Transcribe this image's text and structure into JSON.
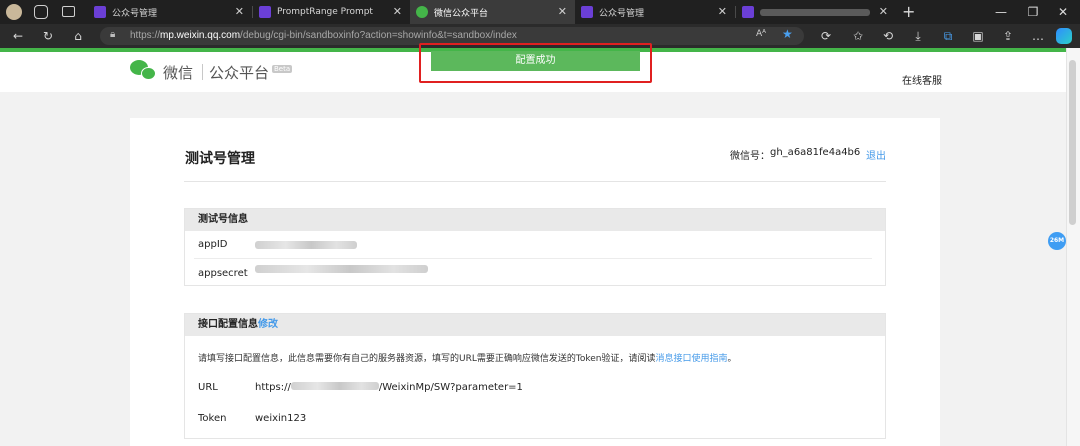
{
  "browser": {
    "tabs": [
      {
        "title": "公众号管理",
        "active": false
      },
      {
        "title": "PromptRange Prompt",
        "active": false
      },
      {
        "title": "微信公众平台",
        "active": true
      },
      {
        "title": "公众号管理",
        "active": false
      },
      {
        "title": "",
        "active": false
      }
    ],
    "url_host": "mp.weixin.qq.com",
    "url_prefix": "https://",
    "url_path": "/debug/cgi-bin/sandboxinfo?action=showinfo&t=sandbox/index",
    "reader_mode": "A ᴬ"
  },
  "header": {
    "brand": "微信",
    "platform": "公众平台",
    "beta": "Beta",
    "online_service": "在线客服",
    "toast": "配置成功"
  },
  "test_account": {
    "title": "测试号管理",
    "wechat_label": "微信号：",
    "wechat_id": "gh_a6a81fe4a4b6",
    "logout": "退出"
  },
  "info_section": {
    "heading": "测试号信息",
    "appid_label": "appID",
    "appsecret_label": "appsecret"
  },
  "config_section": {
    "heading": "接口配置信息",
    "edit_link": "修改",
    "desc": "请填写接口配置信息，此信息需要你有自己的服务器资源，填写的URL需要正确响应微信发送的Token验证，请阅读",
    "guide_link": "消息接口使用指南",
    "desc_end": "。",
    "url_label": "URL",
    "url_prefix": "https://",
    "url_suffix": "/WeixinMp/SW?parameter=1",
    "token_label": "Token",
    "token_value": "weixin123"
  },
  "side_badge": "26M",
  "colors": {
    "accent_green": "#44b549",
    "link_blue": "#459ae9",
    "highlight_red": "#e02020"
  }
}
